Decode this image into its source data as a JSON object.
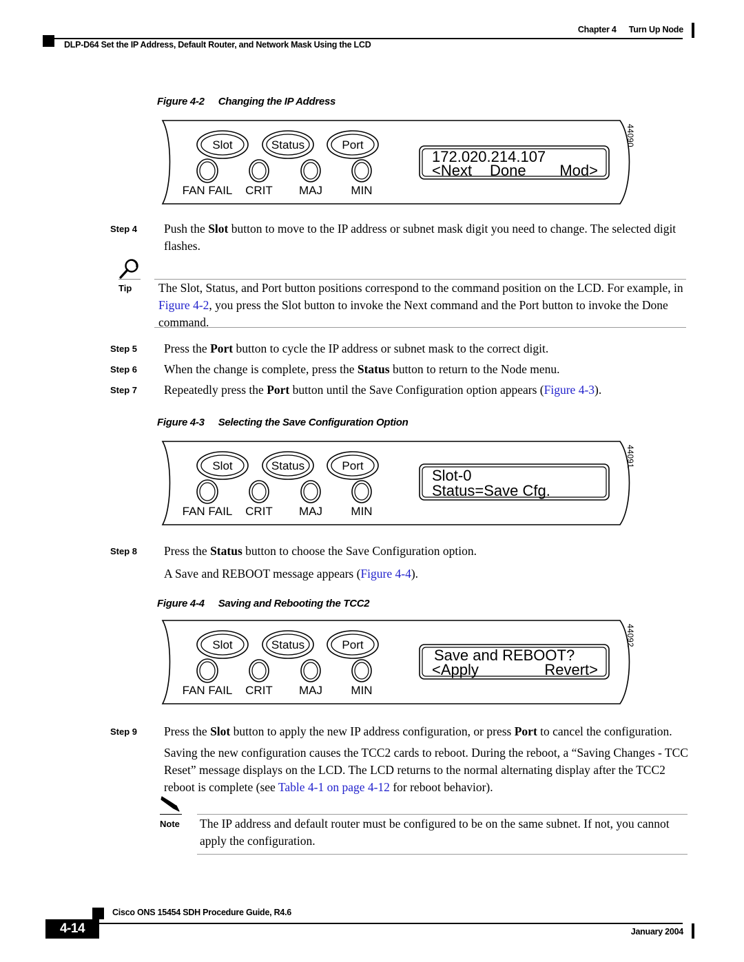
{
  "header": {
    "chapter_label": "Chapter 4",
    "chapter_title": "Turn Up Node",
    "doc_title": "DLP-D64 Set the IP Address, Default Router, and Network Mask Using the LCD"
  },
  "figures": [
    {
      "num": "Figure 4-2",
      "title": "Changing the IP Address",
      "buttons": [
        "Slot",
        "Status",
        "Port"
      ],
      "leds": [
        "FAN FAIL",
        "CRIT",
        "MAJ",
        "MIN"
      ],
      "lcd_line1": "172.020.214.107",
      "lcd_line2_left": "<Next",
      "lcd_line2_mid": "Done",
      "lcd_line2_right": "Mod>",
      "art_id": "44090"
    },
    {
      "num": "Figure 4-3",
      "title": "Selecting the Save Configuration Option",
      "buttons": [
        "Slot",
        "Status",
        "Port"
      ],
      "leds": [
        "FAN FAIL",
        "CRIT",
        "MAJ",
        "MIN"
      ],
      "lcd_line1": "Slot-0",
      "lcd_line2_left": "Status=Save Cfg.",
      "lcd_line2_mid": "",
      "lcd_line2_right": "",
      "art_id": "44091"
    },
    {
      "num": "Figure 4-4",
      "title": "Saving and Rebooting the TCC2",
      "buttons": [
        "Slot",
        "Status",
        "Port"
      ],
      "leds": [
        "FAN FAIL",
        "CRIT",
        "MAJ",
        "MIN"
      ],
      "lcd_line1": "Save and REBOOT?",
      "lcd_line2_left": "<Apply",
      "lcd_line2_mid": "",
      "lcd_line2_right": "Revert>",
      "art_id": "44092"
    }
  ],
  "steps": {
    "step4": {
      "label": "Step 4",
      "part1": "Push the ",
      "bold1": "Slot",
      "part2": " button to move to the IP address or subnet mask digit you need to change. The selected digit flashes."
    },
    "step5": {
      "label": "Step 5",
      "part1": "Press the ",
      "bold1": "Port",
      "part2": " button to cycle the IP address or subnet mask to the correct digit."
    },
    "step6": {
      "label": "Step 6",
      "part1": "When the change is complete, press the ",
      "bold1": "Status",
      "part2": " button to return to the Node menu."
    },
    "step7": {
      "label": "Step 7",
      "part1": "Repeatedly press the ",
      "bold1": "Port",
      "part2": " button until the Save Configuration option appears (",
      "link1": "Figure 4-3",
      "part3": ")."
    },
    "step8": {
      "label": "Step 8",
      "part1": "Press the ",
      "bold1": "Status",
      "part2": " button to choose the Save Configuration option.",
      "para2_part1": "A Save and REBOOT message appears (",
      "para2_link": "Figure 4-4",
      "para2_part2": ")."
    },
    "step9": {
      "label": "Step 9",
      "part1": "Press the ",
      "bold1": "Slot",
      "part2": " button to apply the new IP address configuration, or press ",
      "bold2": "Port",
      "part3": " to cancel the configuration.",
      "para2_part1": "Saving the new configuration causes the TCC2 cards to reboot. During the reboot, a “Saving Changes - TCC Reset” message displays on the LCD. The LCD returns to the normal alternating display after the TCC2 reboot is complete (see ",
      "para2_link": "Table 4-1 on page 4-12",
      "para2_part2": " for reboot behavior)."
    }
  },
  "tip": {
    "label": "Tip",
    "icon": "magnifier-icon",
    "part1": "The Slot, Status, and Port button positions correspond to the command position on the LCD. For example, in ",
    "link1": "Figure 4-2",
    "part2": ", you press the Slot button to invoke the Next command and the Port button to invoke the Done command."
  },
  "note": {
    "label": "Note",
    "icon": "pencil-icon",
    "text": "The IP address and default router must be configured to be on the same subnet. If not, you cannot apply the configuration."
  },
  "footer": {
    "guide_title": "Cisco ONS 15454 SDH Procedure Guide, R4.6",
    "page_number": "4-14",
    "date": "January 2004"
  }
}
